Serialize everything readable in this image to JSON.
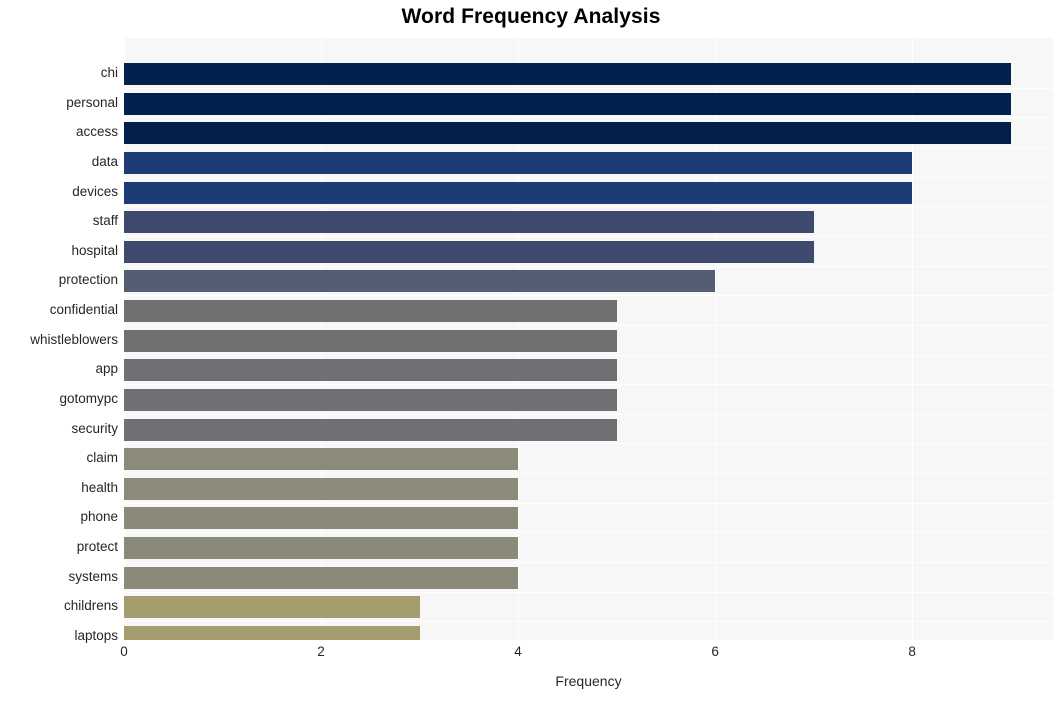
{
  "chart_data": {
    "type": "bar",
    "orientation": "horizontal",
    "title": "Word Frequency Analysis",
    "xlabel": "Frequency",
    "ylabel": "",
    "xlim": [
      0,
      9.43
    ],
    "xticks": [
      0,
      2,
      4,
      6,
      8
    ],
    "xtick_labels": [
      "0",
      "2",
      "4",
      "6",
      "8"
    ],
    "grid": true,
    "grid_color": "#ffffff",
    "plot_background": "#f7f7f8",
    "legend": null,
    "categories": [
      "chi",
      "personal",
      "access",
      "data",
      "devices",
      "staff",
      "hospital",
      "protection",
      "confidential",
      "whistleblowers",
      "app",
      "gotomypc",
      "security",
      "claim",
      "health",
      "phone",
      "protect",
      "systems",
      "childrens",
      "laptops"
    ],
    "values": [
      9,
      9,
      9,
      8,
      8,
      7,
      7,
      6,
      5,
      5,
      5,
      5,
      5,
      4,
      4,
      4,
      4,
      4,
      3,
      3
    ],
    "bar_colors": [
      "#03214d",
      "#03214d",
      "#03204a",
      "#1d3b74",
      "#1d3b74",
      "#3d4a6d",
      "#3d4a6d",
      "#555d72",
      "#707073",
      "#707073",
      "#6f7073",
      "#6f7073",
      "#6f7073",
      "#8c8a79",
      "#8c8a79",
      "#8b8978",
      "#8b8978",
      "#8b8978",
      "#a69d6e",
      "#a69d6e"
    ]
  },
  "axis": {
    "title_color": "#000000",
    "tick_color": "#262626"
  }
}
